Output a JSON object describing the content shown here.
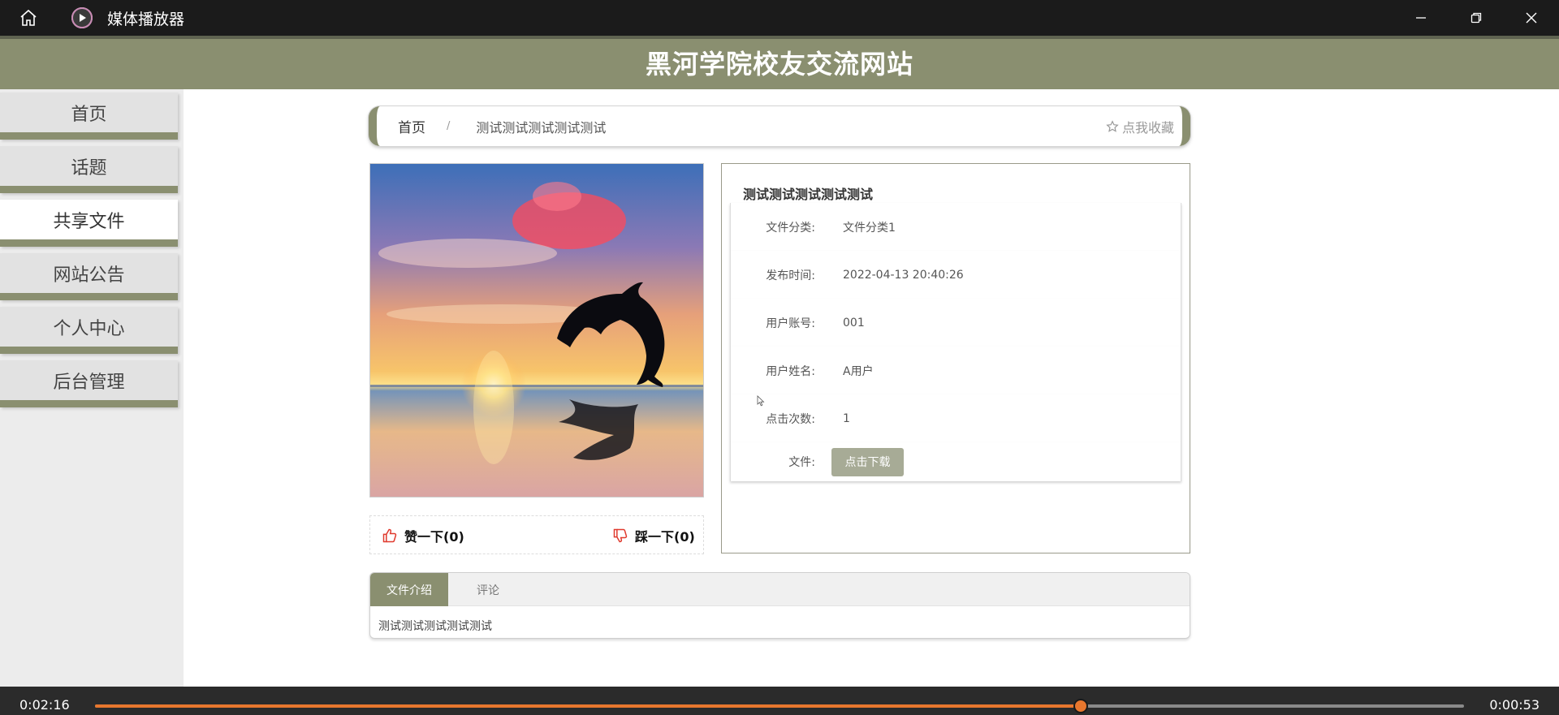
{
  "titlebar": {
    "app_title": "媒体播放器",
    "icons": [
      "home-icon",
      "media-player-icon",
      "minimize-icon",
      "restore-icon",
      "close-icon"
    ]
  },
  "site": {
    "title": "黑河学院校友交流网站"
  },
  "sidebar": {
    "items": [
      {
        "label": "首页",
        "active": false
      },
      {
        "label": "话题",
        "active": false
      },
      {
        "label": "共享文件",
        "active": true
      },
      {
        "label": "网站公告",
        "active": false
      },
      {
        "label": "个人中心",
        "active": false
      },
      {
        "label": "后台管理",
        "active": false
      }
    ]
  },
  "breadcrumb": {
    "home": "首页",
    "separator": "/",
    "current": "测试测试测试测试测试",
    "favorite": "点我收藏"
  },
  "votes": {
    "like": "赞一下(0)",
    "dislike": "踩一下(0)"
  },
  "detail": {
    "title": "测试测试测试测试测试",
    "rows": [
      {
        "label": "文件分类:",
        "value": "文件分类1"
      },
      {
        "label": "发布时间:",
        "value": "2022-04-13 20:40:26"
      },
      {
        "label": "用户账号:",
        "value": "001"
      },
      {
        "label": "用户姓名:",
        "value": "A用户"
      },
      {
        "label": "点击次数:",
        "value": "1"
      }
    ],
    "file_label": "文件:",
    "download_button": "点击下载"
  },
  "tabs": {
    "items": [
      "文件介绍",
      "评论"
    ],
    "active_index": 0,
    "content": "测试测试测试测试测试"
  },
  "player": {
    "elapsed": "0:02:16",
    "remaining": "0:00:53",
    "progress_fraction": 0.72
  },
  "colors": {
    "accent": "#8a8f70",
    "titlebar": "#1b1b1b",
    "progress": "#e8772e"
  }
}
